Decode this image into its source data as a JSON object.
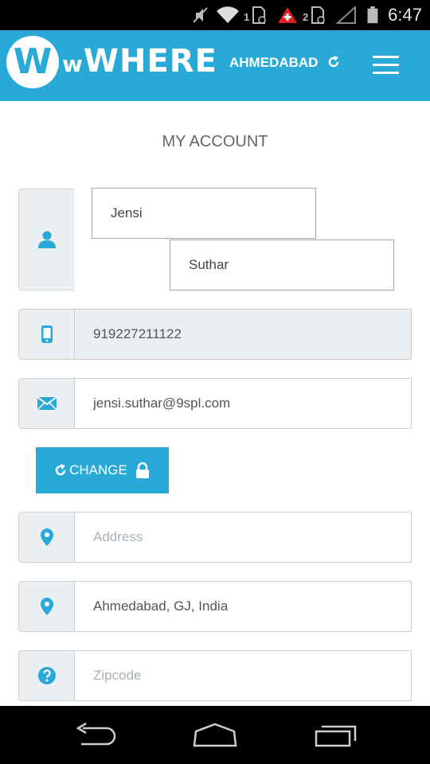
{
  "status_bar": {
    "time": "6:47",
    "sim1_label": "1",
    "sim2_label": "2"
  },
  "app_bar": {
    "logo_text_small": "w",
    "logo_text": "WHERE",
    "logo_badge": "W",
    "city": "AHMEDABAD",
    "accent_color": "#29a9d8"
  },
  "page": {
    "title": "MY ACCOUNT"
  },
  "form": {
    "first_name": "Jensi",
    "last_name": "Suthar",
    "phone": "919227211122",
    "email": "jensi.suthar@9spl.com",
    "change_label": "CHANGE",
    "address_placeholder": "Address",
    "location": "Ahmedabad, GJ, India",
    "zipcode_placeholder": "Zipcode"
  }
}
